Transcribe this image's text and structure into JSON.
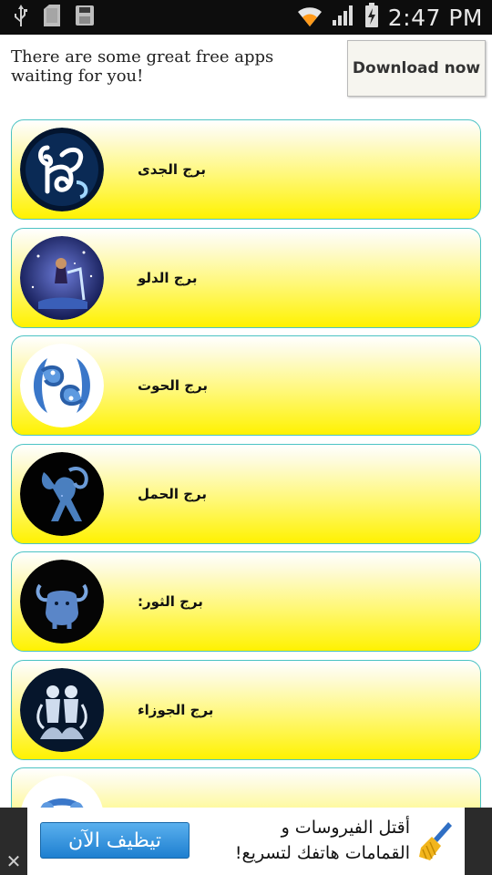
{
  "status_bar": {
    "time": "2:47 PM",
    "left_icons": [
      "usb-icon",
      "sd-card-icon",
      "save-icon"
    ],
    "right_icons": [
      "wifi-icon",
      "signal-icon",
      "battery-charging-icon"
    ]
  },
  "top_ad": {
    "text": "There are some great free apps waiting for you!",
    "button_label": "Download now"
  },
  "zodiac_list": {
    "items": [
      {
        "label": "برج الجدى",
        "icon": "capricorn-icon"
      },
      {
        "label": "برج الدلو",
        "icon": "aquarius-icon"
      },
      {
        "label": "برج الحوت",
        "icon": "pisces-icon"
      },
      {
        "label": "برج الحمل",
        "icon": "aries-icon"
      },
      {
        "label": "برج الثور:",
        "icon": "taurus-icon"
      },
      {
        "label": "برج الجوزاء",
        "icon": "gemini-icon"
      },
      {
        "label": "",
        "icon": "cancer-icon"
      }
    ]
  },
  "bottom_ad": {
    "button_label": "تيظيف الآن",
    "line1": "أقتل الفيروسات و",
    "line2": "القمامات هاتفك لتسريع!",
    "close_label": "✕"
  },
  "colors": {
    "card_border": "#4cc3c3",
    "card_fill_top": "#ffffff",
    "card_fill_bottom": "#fff200",
    "clean_button": "#1e7fd0"
  }
}
